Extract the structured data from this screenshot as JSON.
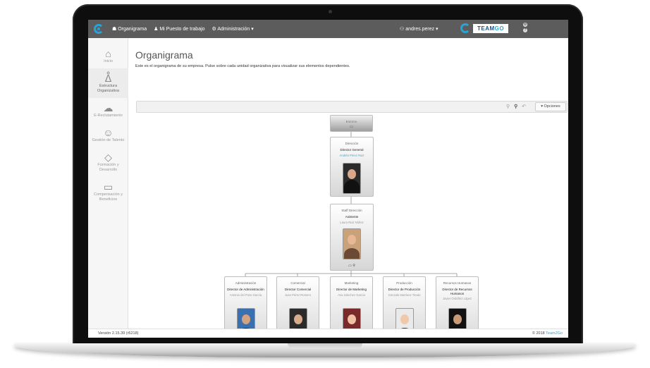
{
  "topbar": {
    "nav": [
      "Organigrama",
      "Mi Puesto de trabajo",
      "Administración"
    ],
    "user": "andres.perez",
    "brand_a": "TEAM",
    "brand_b": "GO"
  },
  "sidebar": {
    "items": [
      {
        "label": "Inicio",
        "icon": "home-icon"
      },
      {
        "label": "Estructura Organizativa",
        "icon": "org-structure-icon"
      },
      {
        "label": "E-Reclutamiento",
        "icon": "recruitment-icon"
      },
      {
        "label": "Gestión de Talento",
        "icon": "talent-icon"
      },
      {
        "label": "Formación y Desarrollo",
        "icon": "training-icon"
      },
      {
        "label": "Compensación y Beneficios",
        "icon": "compensation-icon"
      }
    ]
  },
  "page": {
    "title": "Organigrama",
    "description": "Este es el organigrama de su empresa. Pulse sobre cada unidad organizativa para visualizar sus elementos dependientes.",
    "options_label": "▾ Opciones"
  },
  "org": {
    "root": {
      "unit": "Entorno"
    },
    "director": {
      "unit": "Dirección",
      "position": "Director General",
      "name": "Andrés Pérez Ruiz"
    },
    "assistant": {
      "unit": "Staff Dirección",
      "position": "Asistente",
      "name": "Laura Ruiz Núñez"
    },
    "departments": [
      {
        "unit": "Administración",
        "position": "Director de Administración",
        "name": "Antonio del Pozo García"
      },
      {
        "unit": "Comercial",
        "position": "Director Comercial",
        "name": "Juan Pérez Romero"
      },
      {
        "unit": "Marketing",
        "position": "Director de Marketing",
        "name": "Ana Sánchez García"
      },
      {
        "unit": "Producción",
        "position": "Director de Producción",
        "name": "Gonzalo Martínez Tirado"
      },
      {
        "unit": "Recursos Humanos",
        "position": "Director de Recursos Humanos",
        "name": "Javier Ordóñez López"
      }
    ]
  },
  "footer": {
    "version": "Versión 2.15.39 (r5218)",
    "copyright": "© 2018",
    "copyright_brand": "Team2Go"
  },
  "colors": {
    "topbar": "#5c5c5c",
    "accent": "#29a3d6"
  }
}
